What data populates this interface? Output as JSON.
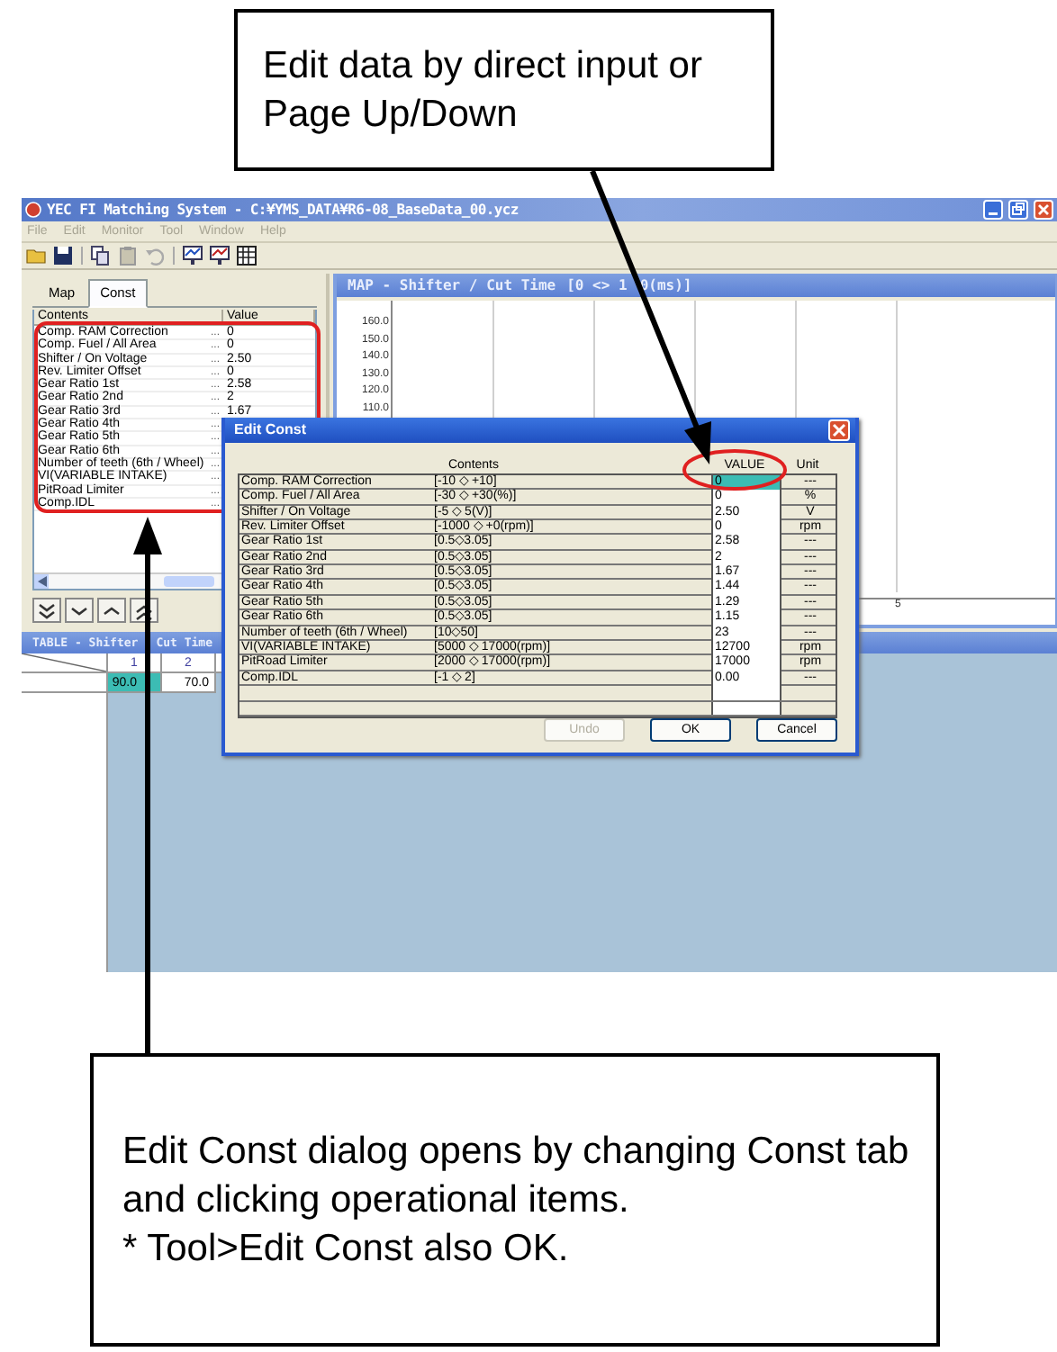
{
  "callouts": [
    {
      "paragraphs": [
        "Edit data by direct input or Page Up/Down"
      ]
    },
    {
      "paragraphs": [
        "Edit Const dialog opens by changing Const tab and clicking operational items.",
        "* Tool>Edit Const also OK."
      ]
    }
  ],
  "window": {
    "title": "YEC FI Matching System - C:¥YMS_DATA¥R6-08_BaseData_00.ycz",
    "menu": [
      {
        "label": "File",
        "disabled": true
      },
      {
        "label": "Edit",
        "disabled": true
      },
      {
        "label": "Monitor",
        "disabled": true
      },
      {
        "label": "Tool",
        "disabled": true
      },
      {
        "label": "Window",
        "disabled": true
      },
      {
        "label": "Help",
        "disabled": true
      }
    ]
  },
  "side_panel": {
    "tabs": [
      {
        "label": "Map",
        "selected": false
      },
      {
        "label": "Const",
        "selected": true
      }
    ],
    "columns": [
      "Contents",
      "Value"
    ],
    "rows": [
      {
        "name": "Comp. RAM Correction",
        "button": "...",
        "value": "0"
      },
      {
        "name": "Comp. Fuel / All Area",
        "button": "...",
        "value": "0"
      },
      {
        "name": "Shifter / On Voltage",
        "button": "...",
        "value": "2.50"
      },
      {
        "name": "Rev. Limiter Offset",
        "button": "...",
        "value": "0"
      },
      {
        "name": "Gear Ratio 1st",
        "button": "...",
        "value": "2.58"
      },
      {
        "name": "Gear Ratio 2nd",
        "button": "...",
        "value": "2"
      },
      {
        "name": "Gear Ratio 3rd",
        "button": "...",
        "value": "1.67"
      },
      {
        "name": "Gear Ratio 4th",
        "button": "..."
      },
      {
        "name": "Gear Ratio 5th",
        "button": "..."
      },
      {
        "name": "Gear Ratio 6th",
        "button": "..."
      },
      {
        "name": "Number of teeth (6th / Wheel)",
        "button": "..."
      },
      {
        "name": "VI(VARIABLE INTAKE)",
        "button": "..."
      },
      {
        "name": "PitRoad Limiter",
        "button": "..."
      },
      {
        "name": "Comp.IDL",
        "button": "..."
      }
    ]
  },
  "map": {
    "title": "MAP - Shifter / Cut Time",
    "range_parts": [
      "[0 <> 1",
      "0(ms)]"
    ],
    "y_labels": [
      "160.0",
      "150.0",
      "140.0",
      "130.0",
      "120.0",
      "110.0"
    ],
    "x_labels": [
      "5"
    ]
  },
  "table": {
    "title_parts": [
      "TABLE - Shifter",
      "Cut Time"
    ],
    "columns": [
      "1",
      "2"
    ],
    "cells": [
      {
        "value": "90.0",
        "selected": true
      },
      {
        "value": "70.0",
        "selected": false
      }
    ]
  },
  "dialog": {
    "title": "Edit Const",
    "columns": [
      "Contents",
      "VALUE",
      "Unit"
    ],
    "rows": [
      {
        "name": "Comp. RAM Correction",
        "range": "[-10 ◇ +10]",
        "value": "0",
        "unit": "---",
        "selected": true
      },
      {
        "name": "Comp. Fuel / All Area",
        "range": "[-30 ◇ +30(%)]",
        "value": "0",
        "unit": "%",
        "selected": false
      },
      {
        "name": "Shifter / On Voltage",
        "range": "[-5 ◇ 5(V)]",
        "value": "2.50",
        "unit": "V",
        "selected": false
      },
      {
        "name": "Rev. Limiter Offset",
        "range": "[-1000 ◇ +0(rpm)]",
        "value": "0",
        "unit": "rpm",
        "selected": false
      },
      {
        "name": "Gear Ratio 1st",
        "range": "[0.5◇3.05]",
        "value": "2.58",
        "unit": "---",
        "selected": false
      },
      {
        "name": "Gear Ratio 2nd",
        "range": "[0.5◇3.05]",
        "value": "2",
        "unit": "---",
        "selected": false
      },
      {
        "name": "Gear Ratio 3rd",
        "range": "[0.5◇3.05]",
        "value": "1.67",
        "unit": "---",
        "selected": false
      },
      {
        "name": "Gear Ratio 4th",
        "range": "[0.5◇3.05]",
        "value": "1.44",
        "unit": "---",
        "selected": false
      },
      {
        "name": "Gear Ratio 5th",
        "range": "[0.5◇3.05]",
        "value": "1.29",
        "unit": "---",
        "selected": false
      },
      {
        "name": "Gear Ratio 6th",
        "range": "[0.5◇3.05]",
        "value": "1.15",
        "unit": "---",
        "selected": false
      },
      {
        "name": "Number of teeth (6th / Wheel)",
        "range": "[10◇50]",
        "value": "23",
        "unit": "---",
        "selected": false
      },
      {
        "name": "VI(VARIABLE INTAKE)",
        "range": "[5000 ◇ 17000(rpm)]",
        "value": "12700",
        "unit": "rpm",
        "selected": false
      },
      {
        "name": "PitRoad Limiter",
        "range": "[2000 ◇ 17000(rpm)]",
        "value": "17000",
        "unit": "rpm",
        "selected": false
      },
      {
        "name": "Comp.IDL",
        "range": "[-1 ◇ 2]",
        "value": "0.00",
        "unit": "---",
        "selected": false
      }
    ],
    "buttons": [
      {
        "label": "Undo",
        "disabled": true
      },
      {
        "label": "OK",
        "disabled": false
      },
      {
        "label": "Cancel",
        "disabled": false
      }
    ]
  }
}
